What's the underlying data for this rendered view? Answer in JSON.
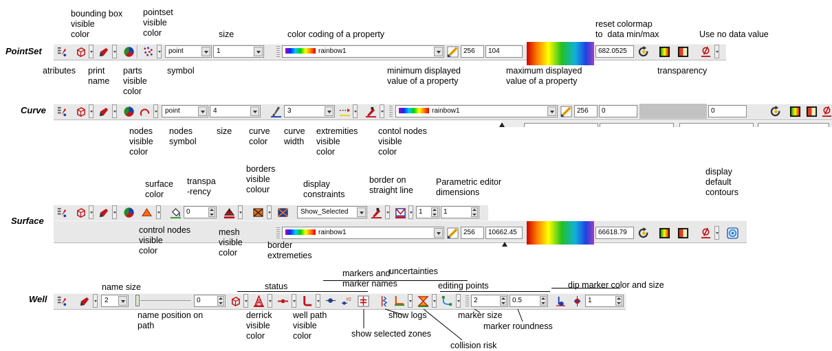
{
  "rows": {
    "pointset": "PointSet",
    "curve": "Curve",
    "surface": "Surface",
    "well": "Well"
  },
  "labels": {
    "bounding_box": "bounding box\nvisible\ncolor",
    "pointset_visible": "pointset\nvisible\ncolor",
    "size": "size",
    "color_coding": "color coding of a property",
    "reset_colormap": "reset colormap\nto  data min/max",
    "use_no_data": "Use no data value",
    "atributes": "atributes",
    "print_name": "print\nname",
    "parts_visible": "parts\nvisible\ncolor",
    "symbol": "symbol",
    "min_displayed": "minimum displayed\nvalue of a property",
    "max_displayed": "maximum displayed\nvalue of a property",
    "transparency": "transparency",
    "nodes_visible": "nodes\nvisible\ncolor",
    "nodes_symbol": "nodes\nsymbol",
    "curve_size": "size",
    "curve_color": "curve\ncolor",
    "curve_width": "curve\nwidth",
    "extremities_visible": "extremities\nvisible\ncolor",
    "contol_nodes": "contol nodes\nvisible\ncolor",
    "surface_color": "surface\ncolor",
    "transparency_short": "transpa\n-rency",
    "borders_visible": "borders\nvisible\ncolour",
    "display_constraints": "display\nconstraints",
    "border_straight": "border on\nstraight line",
    "parametric_editor": "Parametric editor\ndimensions",
    "display_default_contours": "display\ndefault\ncontours",
    "control_nodes": "control nodes\nvisible\ncolor",
    "mesh_visible": "mesh\nvisible\ncolor",
    "border_extremeties": "border\nextremeties",
    "name_size": "name size",
    "status": "status",
    "markers_names": "markers and\nmarker names",
    "uncertainties": "uncertainties",
    "editing_points": "editing points",
    "dip_marker": "dip marker color and size",
    "name_position": "name position on\npath",
    "derrick_visible": "derrick\nvisible\ncolor",
    "well_path_visible": "well path\nvisible\ncolor",
    "show_logs": "show logs",
    "marker_size": "marker size",
    "marker_roundness": "marker roundness",
    "show_selected_zones": "show selected zones",
    "collision_risk": "collision risk"
  },
  "pointset_bar": {
    "symbol_value": "point",
    "size_value": "1",
    "colormap": "rainbow1",
    "colors": "256",
    "min": "104",
    "max": "682.0525"
  },
  "curve_bar": {
    "symbol_value": "point",
    "size_value": "4",
    "width_value": "3",
    "colormap": "rainbow1",
    "colors": "256",
    "min": "0",
    "max": "0"
  },
  "surface_bar": {
    "transparency_value": "0",
    "constraints_value": "Show_Selected",
    "param_u": "1",
    "param_v": "1",
    "colormap": "rainbow1",
    "colors": "256",
    "min": "10662.45",
    "max": "66618.79"
  },
  "well_bar": {
    "name_size_value": "2",
    "name_position_value": "0",
    "marker_size_value": "2",
    "marker_roundness_value": "0.5",
    "dip_size_value": "1"
  },
  "colors": {
    "toolbar": "#e8e8e8",
    "icon_red": "#c0161d",
    "icon_blue": "#1a3fb0"
  }
}
